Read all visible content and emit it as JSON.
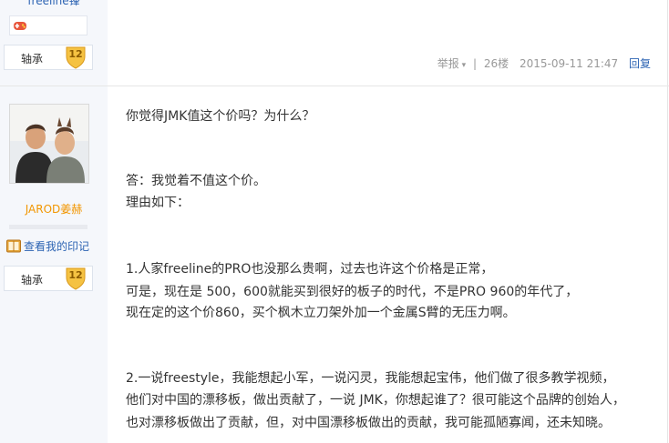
{
  "previous_post": {
    "username_partial": "freeline锋",
    "badge_icon": "game-controller-icon",
    "level": {
      "name": "轴承",
      "number": "12"
    },
    "meta": {
      "report_label": "举报",
      "separator": "|",
      "floor": "26楼",
      "timestamp": "2015-09-11 21:47",
      "reply_label": "回复"
    }
  },
  "current_post": {
    "user": {
      "avatar": "avatar-photo",
      "username": "JAROD姜赫",
      "yinji_label": "查看我的印记",
      "level": {
        "name": "轴承",
        "number": "12"
      }
    },
    "content": {
      "lines": [
        "你觉得JMK值这个价吗？为什么？",
        "答：我觉着不值这个价。",
        "理由如下：",
        "1.人家freeline的PRO也没那么贵啊，过去也许这个价格是正常，",
        "可是，现在是 500，600就能买到很好的板子的时代，不是PRO 960的年代了，",
        "现在定的这个价860，买个枫木立刀架外加一个金属S臂的无压力啊。",
        "2.一说freestyle，我能想起小军，一说闪灵，我能想起宝伟，他们做了很多教学视频，",
        "他们对中国的漂移板，做出贡献了，一说 JMK，你想起谁了？很可能这个品牌的创始人，",
        "也对漂移板做出了贡献，但，对中国漂移板做出的贡献，我可能孤陋寡闻，还未知晓。"
      ]
    }
  },
  "colors": {
    "sidebar_bg": "#f5f7fb",
    "link_blue": "#2d64b3",
    "username_orange": "#f29600",
    "level_gold": "#f5c242"
  }
}
